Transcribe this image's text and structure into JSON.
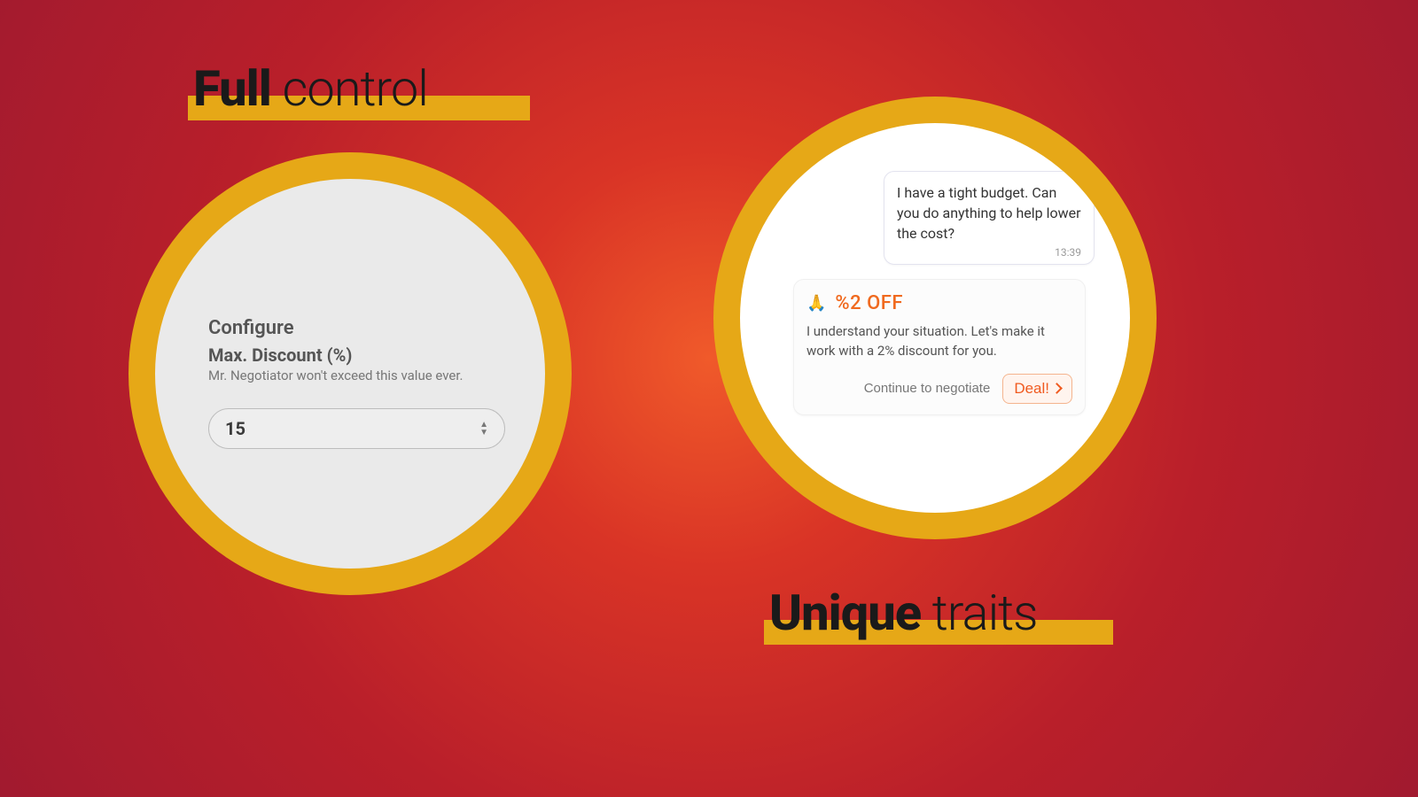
{
  "headings": {
    "top_bold": "Full",
    "top_light": " control",
    "bottom_bold": "Unique",
    "bottom_light": " traits"
  },
  "leftPanel": {
    "title": "Configure",
    "field_label": "Max. Discount (%)",
    "field_help": "Mr. Negotiator won't exceed this value ever.",
    "value": "15"
  },
  "rightPanel": {
    "user_message": "I have a tight budget. Can you do anything to help lower the cost?",
    "user_time": "13:39",
    "offer_emoji": "🙏",
    "offer_label": "%2 OFF",
    "bot_message": "I understand your situation. Let's make it work with a 2% discount for you.",
    "continue_label": "Continue to negotiate",
    "deal_label": "Deal!"
  },
  "colors": {
    "accent_yellow": "#e6a817",
    "accent_orange": "#f05a1f"
  }
}
